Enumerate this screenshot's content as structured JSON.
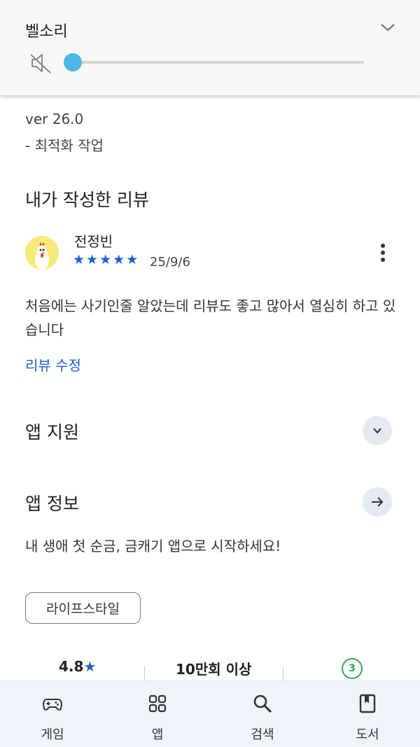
{
  "volume_panel": {
    "title": "벨소리",
    "level": 0,
    "muted": true,
    "icons": {
      "collapse": "chevron-down-icon",
      "mute": "volume-off-icon"
    },
    "accent": "#4cb6e4"
  },
  "whats_new": {
    "version": "ver 26.0",
    "note": "- 최적화 작업"
  },
  "my_review": {
    "section_title": "내가 작성한 리뷰",
    "reviewer": "전정빈",
    "stars": [
      "★",
      "★",
      "★",
      "★",
      "★"
    ],
    "rating": 5,
    "date": "25/9/6",
    "text": "처음에는 사기인줄 알았는데 리뷰도 좋고 많아서 열심히 하고 있습니다",
    "edit_label": "리뷰 수정",
    "accent": "#1a62c7"
  },
  "app_support": {
    "title": "앱 지원",
    "icon": "chevron-down-icon"
  },
  "app_info": {
    "title": "앱 정보",
    "icon": "arrow-right-icon",
    "description": "내 생애 첫 순금, 금캐기 앱으로 시작하세요!",
    "category_chip": "라이프스타일"
  },
  "stats": {
    "rating_value": "4.8",
    "rating_star": "★",
    "downloads": "10만회 이상",
    "age_rating": "3",
    "age_color": "#34a853"
  },
  "bottom_nav": {
    "items": [
      {
        "label": "게임",
        "icon": "gamepad-icon"
      },
      {
        "label": "앱",
        "icon": "apps-grid-icon"
      },
      {
        "label": "검색",
        "icon": "search-icon"
      },
      {
        "label": "도서",
        "icon": "book-icon"
      }
    ]
  }
}
